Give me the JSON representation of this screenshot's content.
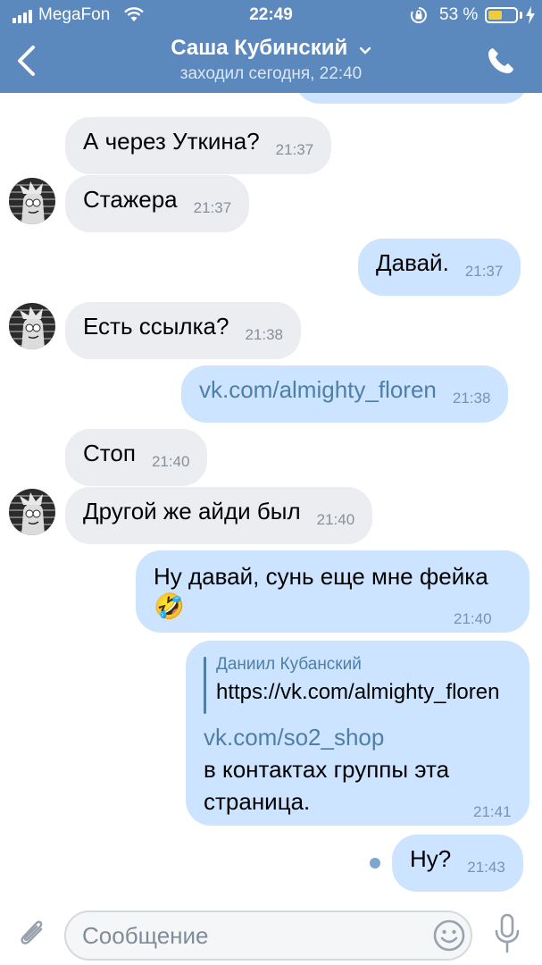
{
  "status_bar": {
    "carrier": "MegaFon",
    "time": "22:49",
    "battery_percent": "53 %",
    "battery_level": 0.53
  },
  "header": {
    "title": "Саша Кубинский",
    "subtitle": "заходил сегодня, 22:40"
  },
  "messages": [
    {
      "direction": "in",
      "text": "А через Уткина?",
      "time": "21:37"
    },
    {
      "direction": "in",
      "text": "Стажера",
      "time": "21:37"
    },
    {
      "direction": "out",
      "text": "Давай.",
      "time": "21:37"
    },
    {
      "direction": "in",
      "text": "Есть ссылка?",
      "time": "21:38"
    },
    {
      "direction": "out",
      "text": "vk.com/almighty_floren",
      "time": "21:38",
      "link": true
    },
    {
      "direction": "in",
      "text": "Стоп",
      "time": "21:40"
    },
    {
      "direction": "in",
      "text": "Другой же айди был",
      "time": "21:40"
    },
    {
      "direction": "out",
      "text": "Ну давай, сунь еще мне фейка",
      "emoji": "🤣",
      "time": "21:40"
    },
    {
      "direction": "out",
      "reply_author": "Даниил Кубанский",
      "reply_text": "https://vk.com/almighty_floren",
      "link": "vk.com/so2_shop",
      "line1": "в контактах группы эта",
      "line2": "страница.",
      "time": "21:41"
    },
    {
      "direction": "out",
      "text": "Ну?",
      "time": "21:43",
      "unread": true
    }
  ],
  "input": {
    "placeholder": "Сообщение"
  },
  "icons": [
    "back-icon",
    "chevron-down-icon",
    "phone-icon",
    "attach-icon",
    "emoji-icon",
    "microphone-icon",
    "lock-rotation-icon",
    "wifi-icon",
    "charging-bolt-icon"
  ],
  "colors": {
    "header": "#5b88bd",
    "incoming_bubble": "#ebedf0",
    "outgoing_bubble": "#cce4ff",
    "link": "#4f7ea8",
    "battery_fill": "#f2cd3a"
  }
}
